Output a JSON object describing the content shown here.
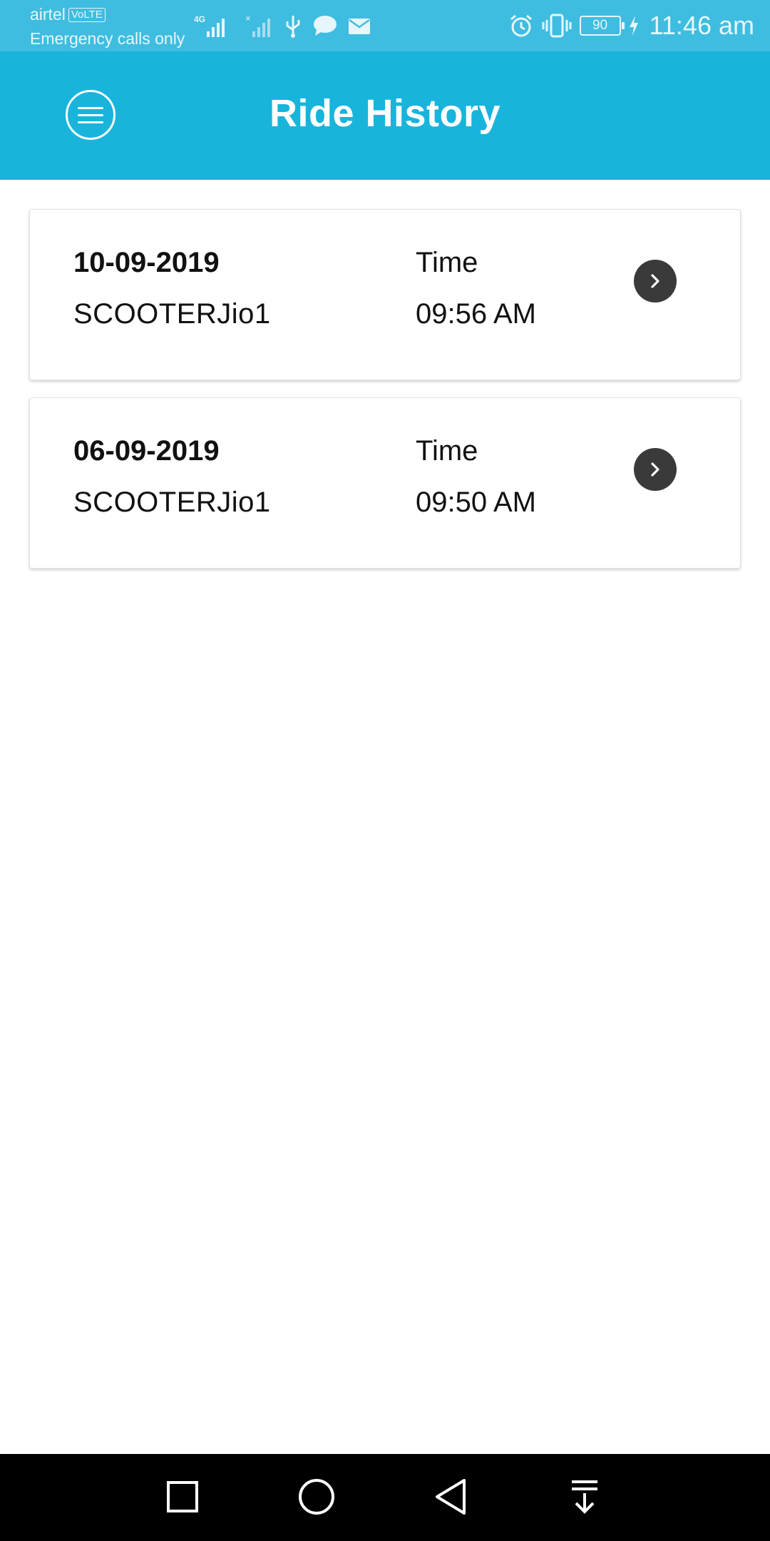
{
  "status_bar": {
    "carrier": "airtel",
    "volte": "VoLTE",
    "emergency": "Emergency calls only",
    "network": "4G",
    "battery": "90",
    "time": "11:46 am"
  },
  "header": {
    "title": "Ride History",
    "background_color": "#18b4dc"
  },
  "rides": [
    {
      "date": "10-09-2019",
      "vehicle": "SCOOTERJio1",
      "time_label": "Time",
      "time": "09:56 AM"
    },
    {
      "date": "06-09-2019",
      "vehicle": "SCOOTERJio1",
      "time_label": "Time",
      "time": "09:50 AM"
    }
  ],
  "nav_bar": {
    "icons": [
      "recent-apps-icon",
      "home-icon",
      "back-icon",
      "notification-pulldown-icon"
    ]
  }
}
